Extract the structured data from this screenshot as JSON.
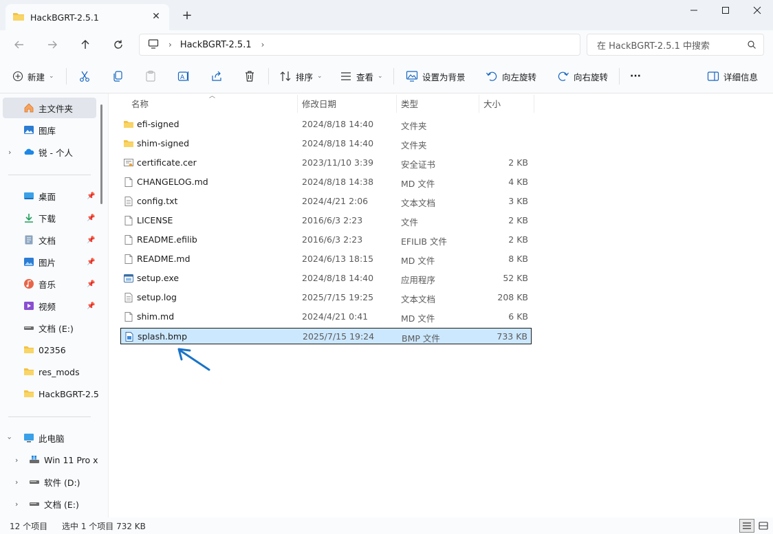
{
  "window": {
    "tab_title": "HackBGRT-2.5.1",
    "new_tab": "+",
    "close_tab": "✕"
  },
  "address": {
    "crumb": "HackBGRT-2.5.1",
    "search_placeholder": "在 HackBGRT-2.5.1 中搜索"
  },
  "toolbar": {
    "new": "新建",
    "sort": "排序",
    "view": "查看",
    "set_background": "设置为背景",
    "rotate_left": "向左旋转",
    "rotate_right": "向右旋转",
    "more": "···",
    "details": "详细信息"
  },
  "sidebar": {
    "items": [
      {
        "label": "主文件夹",
        "icon": "home-icon",
        "pinned": false
      },
      {
        "label": "图库",
        "icon": "gallery-icon",
        "pinned": false
      },
      {
        "label": "锐 - 个人",
        "icon": "onedrive-icon",
        "pinned": false
      },
      {
        "label": "桌面",
        "icon": "desktop-icon",
        "pinned": true
      },
      {
        "label": "下载",
        "icon": "download-icon",
        "pinned": true
      },
      {
        "label": "文档",
        "icon": "documents-icon",
        "pinned": true
      },
      {
        "label": "图片",
        "icon": "pictures-icon",
        "pinned": true
      },
      {
        "label": "音乐",
        "icon": "music-icon",
        "pinned": true
      },
      {
        "label": "视频",
        "icon": "videos-icon",
        "pinned": true
      },
      {
        "label": "文档 (E:)",
        "icon": "drive-icon",
        "pinned": false
      },
      {
        "label": "02356",
        "icon": "folder-icon",
        "pinned": false
      },
      {
        "label": "res_mods",
        "icon": "folder-icon",
        "pinned": false
      },
      {
        "label": "HackBGRT-2.5",
        "icon": "folder-icon",
        "pinned": false
      },
      {
        "label": "此电脑",
        "icon": "pc-icon",
        "pinned": false
      },
      {
        "label": "Win 11 Pro x",
        "icon": "windows-drive-icon",
        "pinned": false
      },
      {
        "label": "软件 (D:)",
        "icon": "drive-icon",
        "pinned": false
      },
      {
        "label": "文档 (E:)",
        "icon": "drive-icon",
        "pinned": false
      }
    ]
  },
  "columns": {
    "name": "名称",
    "date": "修改日期",
    "type": "类型",
    "size": "大小"
  },
  "files": [
    {
      "name": "efi-signed",
      "date": "2024/8/18 14:40",
      "type": "文件夹",
      "size": "",
      "icon": "folder-icon"
    },
    {
      "name": "shim-signed",
      "date": "2024/8/18 14:40",
      "type": "文件夹",
      "size": "",
      "icon": "folder-icon"
    },
    {
      "name": "certificate.cer",
      "date": "2023/11/10 3:39",
      "type": "安全证书",
      "size": "2 KB",
      "icon": "certificate-icon"
    },
    {
      "name": "CHANGELOG.md",
      "date": "2024/8/18 14:38",
      "type": "MD 文件",
      "size": "4 KB",
      "icon": "file-icon"
    },
    {
      "name": "config.txt",
      "date": "2024/4/21 2:06",
      "type": "文本文档",
      "size": "3 KB",
      "icon": "text-file-icon"
    },
    {
      "name": "LICENSE",
      "date": "2016/6/3 2:23",
      "type": "文件",
      "size": "2 KB",
      "icon": "file-icon"
    },
    {
      "name": "README.efilib",
      "date": "2016/6/3 2:23",
      "type": "EFILIB 文件",
      "size": "2 KB",
      "icon": "file-icon"
    },
    {
      "name": "README.md",
      "date": "2024/6/13 18:15",
      "type": "MD 文件",
      "size": "8 KB",
      "icon": "file-icon"
    },
    {
      "name": "setup.exe",
      "date": "2024/8/18 14:40",
      "type": "应用程序",
      "size": "52 KB",
      "icon": "exe-icon"
    },
    {
      "name": "setup.log",
      "date": "2025/7/15 19:25",
      "type": "文本文档",
      "size": "208 KB",
      "icon": "text-file-icon"
    },
    {
      "name": "shim.md",
      "date": "2024/4/21 0:41",
      "type": "MD 文件",
      "size": "6 KB",
      "icon": "file-icon"
    },
    {
      "name": "splash.bmp",
      "date": "2025/7/15 19:24",
      "type": "BMP 文件",
      "size": "733 KB",
      "icon": "image-file-icon",
      "selected": true
    }
  ],
  "status": {
    "count": "12 个项目",
    "selection": "选中 1 个项目  732 KB"
  },
  "colors": {
    "selection_bg": "#cce8ff",
    "folder": "#f4c244",
    "accent": "#0067c0",
    "arrow": "#1a73c7"
  }
}
